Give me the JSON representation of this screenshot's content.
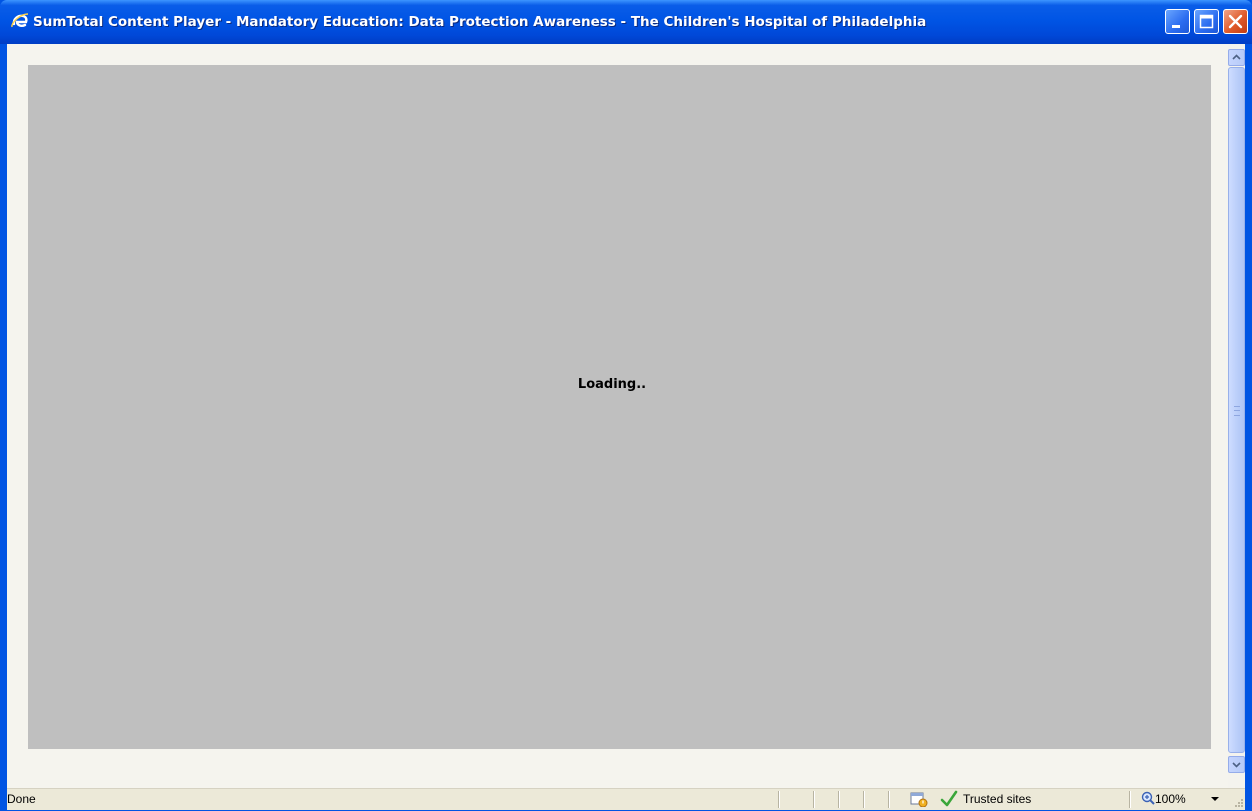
{
  "window": {
    "title": "SumTotal Content Player - Mandatory Education: Data Protection Awareness - The Children's Hospital of Philadelphia",
    "icon": "ie-icon",
    "controls": [
      "minimize",
      "maximize",
      "close"
    ]
  },
  "content": {
    "loading_text": "Loading.."
  },
  "statusbar": {
    "status": "Done",
    "security_zone": "Trusted sites",
    "zoom": "100%"
  },
  "colors": {
    "titlebar": "#0055e5",
    "panel": "#bfbfbf",
    "client": "#f5f4ee",
    "statusbar": "#ece9d8"
  }
}
